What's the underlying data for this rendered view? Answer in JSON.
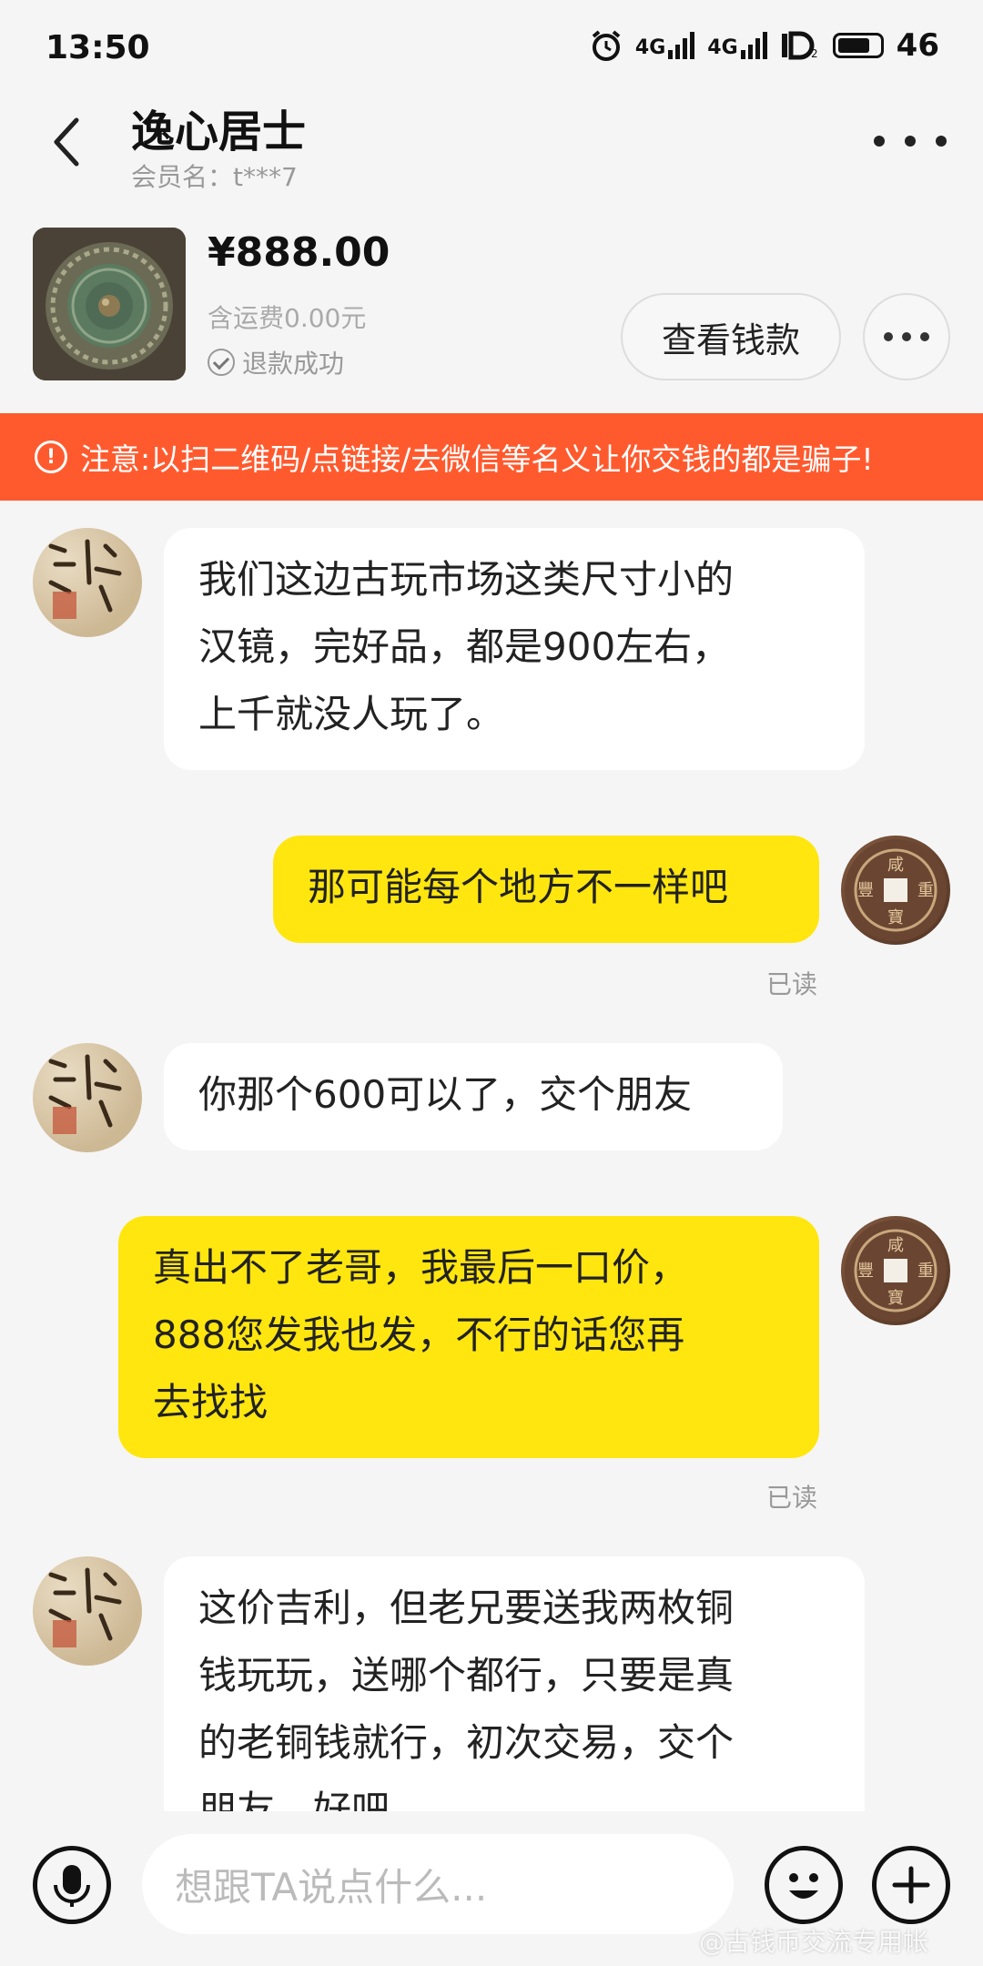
{
  "status_bar": {
    "time": "13:50",
    "network_1": "4G",
    "network_2": "4G",
    "battery_level": "46",
    "icons": [
      "alarm-icon",
      "signal-icon",
      "signal-icon",
      "hd-icon",
      "battery-icon"
    ]
  },
  "header": {
    "title": "逸心居士",
    "member_label": "会员名：t***7",
    "back_icon": "chevron-left-icon",
    "more_icon": "more-horizontal-icon"
  },
  "product": {
    "price": "¥888.00",
    "shipping": "含运费0.00元",
    "status": "退款成功",
    "view_button": "查看钱款"
  },
  "warning": {
    "icon_text": "!",
    "text": "注意:以扫二维码/点链接/去微信等名义让你交钱的都是骗子!"
  },
  "messages": [
    {
      "sender": "them",
      "text": "我们这边古玩市场这类尺寸小的\n汉镜，完好品，都是900左右，\n上千就没人玩了。"
    },
    {
      "sender": "me",
      "text": "那可能每个地方不一样吧",
      "read": "已读"
    },
    {
      "sender": "them",
      "text": "你那个600可以了，交个朋友"
    },
    {
      "sender": "me",
      "text": "真出不了老哥，我最后一口价，\n888您发我也发，不行的话您再\n去找找",
      "read": "已读"
    },
    {
      "sender": "them",
      "text": "这价吉利，但老兄要送我两枚铜\n钱玩玩，送哪个都行，只要是真\n的老铜钱就行，初次交易，交个\n朋友，好吧"
    }
  ],
  "input_bar": {
    "placeholder": "想跟TA说点什么...",
    "watermark": "@古钱币交流专用帐"
  },
  "colors": {
    "warning_bg": "#ff5a2e",
    "my_bubble": "#ffe60f",
    "their_bubble": "#ffffff",
    "background": "#f5f5f5"
  }
}
